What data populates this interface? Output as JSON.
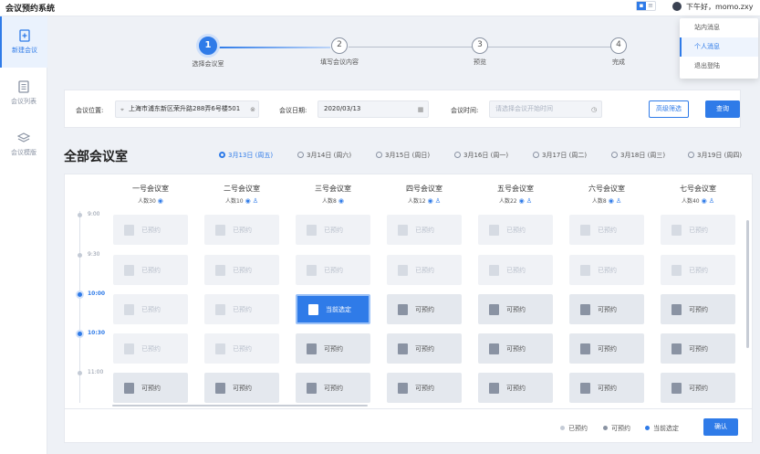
{
  "app": {
    "title": "会议预约系统"
  },
  "header": {
    "view_toggle": [
      "▪",
      "≡"
    ],
    "greeting": "下午好，momo.zxy"
  },
  "user_menu": [
    "站内消息",
    "个人消息",
    "退出登陆"
  ],
  "sidebar": {
    "items": [
      {
        "label": "新建会议",
        "icon": "add-document-icon",
        "active": true
      },
      {
        "label": "会议列表",
        "icon": "list-icon",
        "active": false
      },
      {
        "label": "会议模版",
        "icon": "layers-icon",
        "active": false
      }
    ]
  },
  "steps": [
    {
      "number": "1",
      "label": "选择会议室",
      "active": true
    },
    {
      "number": "2",
      "label": "填写会议内容",
      "active": false
    },
    {
      "number": "3",
      "label": "预览",
      "active": false
    },
    {
      "number": "4",
      "label": "完成",
      "active": false
    }
  ],
  "filter": {
    "location_label": "会议位置:",
    "location_value": "上海市浦东新区荣升路288弄6号楼501",
    "date_label": "会议日期:",
    "date_value": "2020/03/13",
    "time_label": "会议时间:",
    "time_placeholder": "请选择会议开始时间",
    "advanced_button": "高级筛选",
    "search_button": "查询"
  },
  "section": {
    "title": "全部会议室"
  },
  "dates": [
    {
      "label": "3月13日 (周五)",
      "active": true
    },
    {
      "label": "3月14日 (周六)",
      "active": false
    },
    {
      "label": "3月15日 (周日)",
      "active": false
    },
    {
      "label": "3月16日 (周一)",
      "active": false
    },
    {
      "label": "3月17日 (周二)",
      "active": false
    },
    {
      "label": "3月18日 (周三)",
      "active": false
    },
    {
      "label": "3月19日 (周四)",
      "active": false
    }
  ],
  "times": [
    {
      "label": "9:00",
      "active": false
    },
    {
      "label": "9:30",
      "active": false
    },
    {
      "label": "10:00",
      "active": true
    },
    {
      "label": "10:30",
      "active": true
    },
    {
      "label": "11:00",
      "active": false
    }
  ],
  "rooms": [
    {
      "name": "一号会议室",
      "capacity": "人数30",
      "has_person_icon": false,
      "slots": [
        "booked",
        "booked",
        "booked",
        "booked",
        "available"
      ]
    },
    {
      "name": "二号会议室",
      "capacity": "人数10",
      "has_person_icon": true,
      "slots": [
        "booked",
        "booked",
        "booked",
        "booked",
        "available"
      ]
    },
    {
      "name": "三号会议室",
      "capacity": "人数8",
      "has_person_icon": false,
      "slots": [
        "booked",
        "booked",
        "selected",
        "available",
        "available"
      ]
    },
    {
      "name": "四号会议室",
      "capacity": "人数12",
      "has_person_icon": true,
      "slots": [
        "booked",
        "booked",
        "available",
        "available",
        "available"
      ]
    },
    {
      "name": "五号会议室",
      "capacity": "人数22",
      "has_person_icon": true,
      "slots": [
        "booked",
        "booked",
        "available",
        "available",
        "available"
      ]
    },
    {
      "name": "六号会议室",
      "capacity": "人数8",
      "has_person_icon": true,
      "slots": [
        "booked",
        "booked",
        "available",
        "available",
        "available"
      ]
    },
    {
      "name": "七号会议室",
      "capacity": "人数40",
      "has_person_icon": true,
      "slots": [
        "booked",
        "booked",
        "available",
        "available",
        "available"
      ]
    }
  ],
  "slot_labels": {
    "booked": "已预约",
    "available": "可预约",
    "selected": "当前选定"
  },
  "legend": [
    {
      "label": "已预约",
      "color": "#c4cbd6"
    },
    {
      "label": "可预约",
      "color": "#8a93a3"
    },
    {
      "label": "当前选定",
      "color": "#2f7be8"
    }
  ],
  "confirm_button": "确认",
  "colors": {
    "accent": "#2f7be8"
  }
}
